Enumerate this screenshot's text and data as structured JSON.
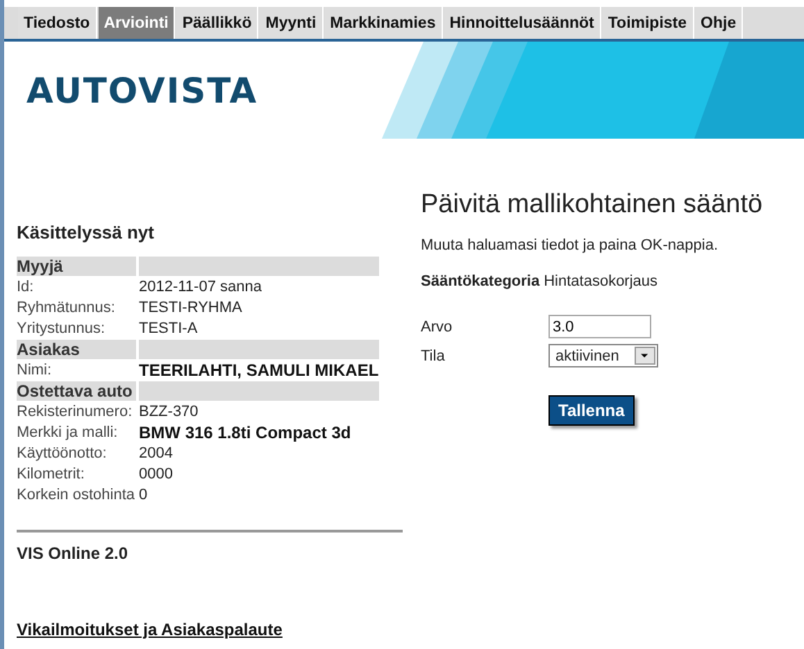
{
  "menu": [
    {
      "label": "Tiedosto",
      "selected": false
    },
    {
      "label": "Arviointi",
      "selected": true
    },
    {
      "label": "Päällikkö",
      "selected": false
    },
    {
      "label": "Myynti",
      "selected": false
    },
    {
      "label": "Markkinamies",
      "selected": false
    },
    {
      "label": "Hinnoittelusäännöt",
      "selected": false
    },
    {
      "label": "Toimipiste",
      "selected": false
    },
    {
      "label": "Ohje",
      "selected": false
    }
  ],
  "logo": "AUTOVISTA",
  "sidebar": {
    "title": "Käsittelyssä nyt",
    "sections": [
      {
        "heading": "Myyjä",
        "rows": [
          {
            "label": "Id:",
            "value": "2012-11-07  sanna",
            "strong": false
          },
          {
            "label": "Ryhmätunnus:",
            "value": "TESTI-RYHMA",
            "strong": false
          },
          {
            "label": "Yritystunnus:",
            "value": "TESTI-A",
            "strong": false
          }
        ]
      },
      {
        "heading": "Asiakas",
        "rows": [
          {
            "label": "Nimi:",
            "value": "TEERILAHTI, SAMULI MIKAEL",
            "strong": true
          }
        ]
      },
      {
        "heading": "Ostettava auto",
        "rows": [
          {
            "label": "Rekisterinumero:",
            "value": "BZZ-370",
            "strong": false
          },
          {
            "label": "Merkki ja malli:",
            "value": "BMW 316 1.8ti Compact 3d",
            "strong": true
          },
          {
            "label": "Käyttöönotto:",
            "value": "2004",
            "strong": false
          },
          {
            "label": "Kilometrit:",
            "value": "0000",
            "strong": false
          },
          {
            "label": "Korkein ostohinta",
            "value": "0",
            "strong": false
          }
        ]
      }
    ],
    "version": "VIS Online 2.0",
    "feedback_link": "Vikailmoitukset ja Asiakaspalaute"
  },
  "form": {
    "title": "Päivitä mallikohtainen sääntö",
    "instruction": "Muuta haluamasi tiedot ja paina OK-nappia.",
    "category_label": "Sääntökategoria",
    "category_value": "Hintatasokorjaus",
    "fields": [
      {
        "label": "Arvo",
        "kind": "text",
        "value": "3.0"
      },
      {
        "label": "Tila",
        "kind": "select",
        "value": "aktiivinen"
      }
    ],
    "submit": "Tallenna"
  }
}
